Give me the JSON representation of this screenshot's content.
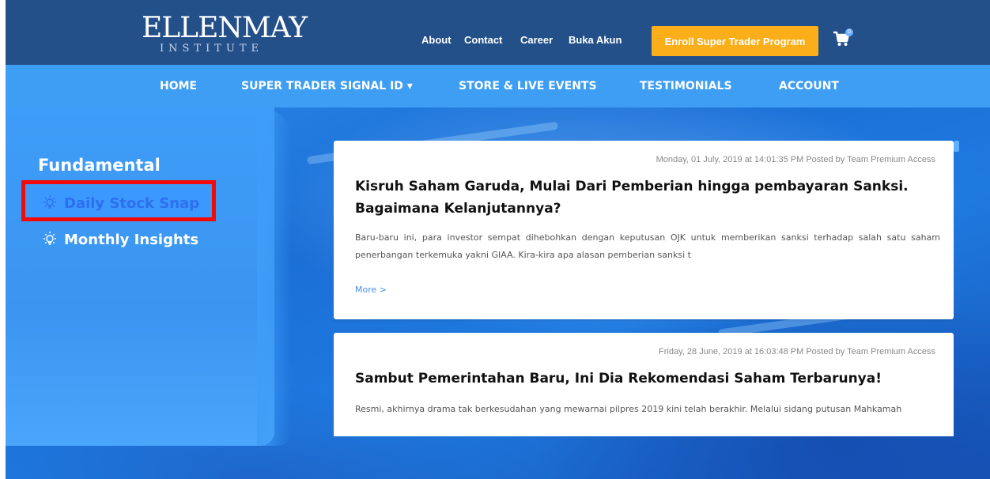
{
  "brand": {
    "name": "ELLENMAY",
    "sub": "INSTITUTE"
  },
  "top_links": [
    "About",
    "Contact",
    "Career",
    "Buka Akun"
  ],
  "enroll_label": "Enroll Super Trader Program",
  "cart": {
    "icon": "cart-icon",
    "count": "0"
  },
  "main_nav": [
    "HOME",
    "SUPER TRADER SIGNAL ID ▾",
    "STORE & LIVE EVENTS",
    "TESTIMONIALS",
    "ACCOUNT"
  ],
  "sidebar": {
    "title": "Fundamental",
    "items": [
      {
        "label": "Daily Stock Snap",
        "icon": "lightbulb-icon",
        "highlighted": true
      },
      {
        "label": "Monthly Insights",
        "icon": "lightbulb-icon",
        "highlighted": false
      }
    ]
  },
  "posts": [
    {
      "meta": "Monday, 01 July, 2019 at 14:01:35 PM Posted by Team Premium Access",
      "title": "Kisruh Saham Garuda, Mulai Dari Pemberian hingga pembayaran Sanksi. Bagaimana Kelanjutannya?",
      "excerpt": "Baru-baru ini, para investor sempat dihebohkan dengan keputusan OJK untuk memberikan sanksi terhadap salah satu saham penerbangan terkemuka yakni GIAA. Kira-kira apa alasan pemberian sanksi t",
      "more": "More >"
    },
    {
      "meta": "Friday, 28 June, 2019 at 16:03:48 PM Posted by Team Premium Access",
      "title": "Sambut Pemerintahan Baru, Ini Dia Rekomendasi Saham Terbarunya!",
      "excerpt": "Resmi, akhirnya drama tak berkesudahan yang mewarnai pilpres 2019 kini telah berakhir. Melalui sidang putusan Mahkamah"
    }
  ],
  "colors": {
    "topbar": "#24508a",
    "nav": "#3d9ef4",
    "enroll": "#f9ae1a",
    "highlight": "#f20a0a"
  }
}
